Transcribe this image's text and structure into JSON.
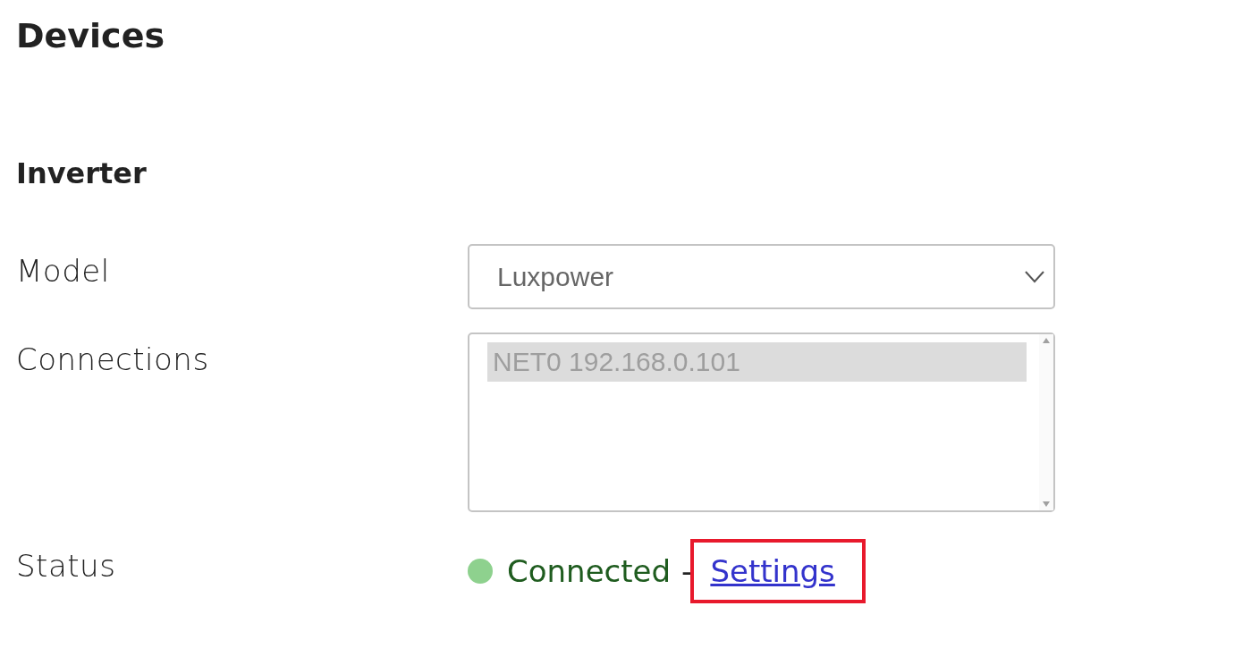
{
  "title": "Devices",
  "section": {
    "title": "Inverter",
    "model": {
      "label": "Model",
      "value": "Luxpower"
    },
    "connections": {
      "label": "Connections",
      "items": [
        {
          "text": "NET0 192.168.0.101",
          "selected": true
        }
      ]
    },
    "status": {
      "label": "Status",
      "text": "Connected",
      "color": "#8ed18e",
      "separator": "-",
      "link": "Settings",
      "highlighted": true
    }
  }
}
